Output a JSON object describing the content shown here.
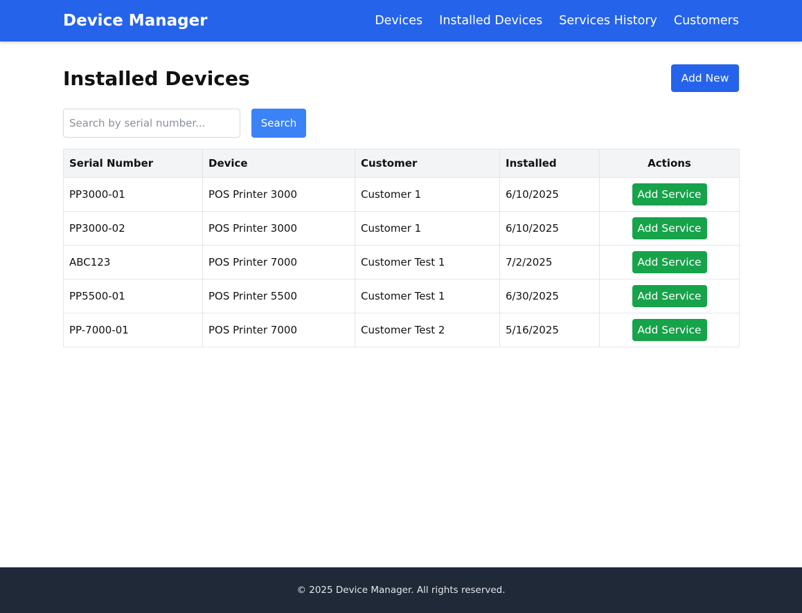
{
  "header": {
    "brand": "Device Manager",
    "nav": [
      {
        "label": "Devices"
      },
      {
        "label": "Installed Devices"
      },
      {
        "label": "Services History"
      },
      {
        "label": "Customers"
      }
    ]
  },
  "main": {
    "title": "Installed Devices",
    "add_new_label": "Add New",
    "search": {
      "placeholder": "Search by serial number...",
      "value": "",
      "button_label": "Search"
    },
    "table": {
      "columns": [
        "Serial Number",
        "Device",
        "Customer",
        "Installed",
        "Actions"
      ],
      "rows": [
        {
          "serial": "PP3000-01",
          "device": "POS Printer 3000",
          "customer": "Customer 1",
          "installed": "6/10/2025",
          "action": "Add Service"
        },
        {
          "serial": "PP3000-02",
          "device": "POS Printer 3000",
          "customer": "Customer 1",
          "installed": "6/10/2025",
          "action": "Add Service"
        },
        {
          "serial": "ABC123",
          "device": "POS Printer 7000",
          "customer": "Customer Test 1",
          "installed": "7/2/2025",
          "action": "Add Service"
        },
        {
          "serial": "PP5500-01",
          "device": "POS Printer 5500",
          "customer": "Customer Test 1",
          "installed": "6/30/2025",
          "action": "Add Service"
        },
        {
          "serial": "PP-7000-01",
          "device": "POS Printer 7000",
          "customer": "Customer Test 2",
          "installed": "5/16/2025",
          "action": "Add Service"
        }
      ]
    }
  },
  "footer": {
    "text": "© 2025 Device Manager. All rights reserved."
  },
  "colors": {
    "primary": "#2563eb",
    "search_button": "#3b82f6",
    "success": "#16a34a",
    "footer_bg": "#1f2937",
    "table_header_bg": "#f3f4f6"
  }
}
